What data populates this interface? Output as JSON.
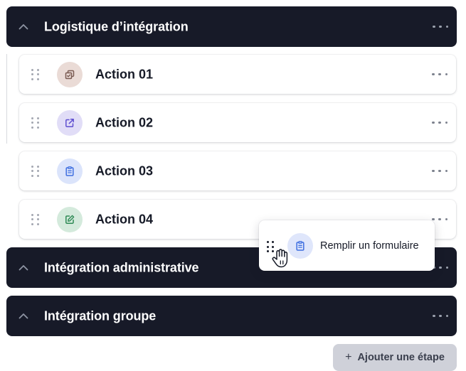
{
  "sections": [
    {
      "title": "Logistique d’intégration",
      "expanded": true
    },
    {
      "title": "Intégration administrative",
      "expanded": true
    },
    {
      "title": "Intégration groupe",
      "expanded": true
    }
  ],
  "actions": [
    {
      "label": "Action 01",
      "icon": "copy-icon",
      "badge_color": "#eadbd6",
      "icon_color": "#7a5b52"
    },
    {
      "label": "Action 02",
      "icon": "external-link-icon",
      "badge_color": "#e1ddf7",
      "icon_color": "#5f4fd0"
    },
    {
      "label": "Action 03",
      "icon": "clipboard-icon",
      "badge_color": "#dbe4fb",
      "icon_color": "#3f6fe0"
    },
    {
      "label": "Action 04",
      "icon": "edit-icon",
      "badge_color": "#d4eadc",
      "icon_color": "#2e8a55"
    }
  ],
  "drag_preview": {
    "label": "Remplir un formulaire",
    "icon": "clipboard-icon"
  },
  "add_step": {
    "plus": "+",
    "label": "Ajouter une étape"
  },
  "colors": {
    "section_bg": "#171a28",
    "card_bg": "#ffffff",
    "button_bg": "#cfd1d9"
  }
}
